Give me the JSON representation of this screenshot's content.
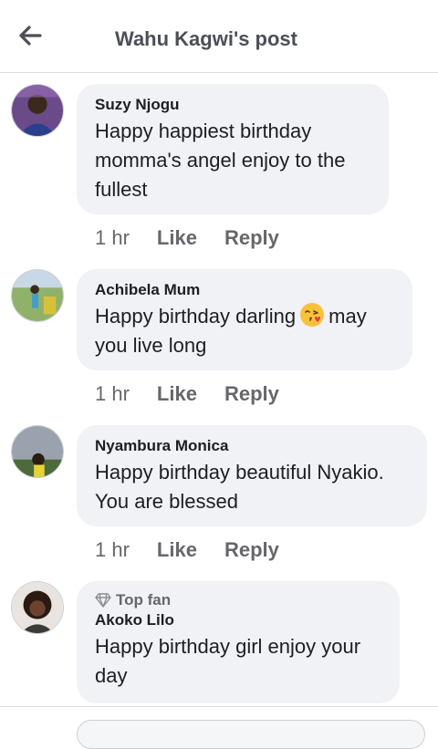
{
  "header": {
    "title": "Wahu Kagwi's post",
    "back_icon": "arrow-left-icon"
  },
  "comments": [
    {
      "author": "Suzy Njogu",
      "text": "Happy happiest birthday momma's angel enjoy to the fullest",
      "time": "1 hr",
      "like": "Like",
      "reply": "Reply"
    },
    {
      "author": "Achibela Mum",
      "text_before": "Happy birthday darling",
      "emoji": "face-blowing-kiss",
      "text_after": "may you live long",
      "time": "1 hr",
      "like": "Like",
      "reply": "Reply"
    },
    {
      "author": "Nyambura Monica",
      "text": "Happy birthday beautiful Nyakio. You are blessed",
      "time": "1 hr",
      "like": "Like",
      "reply": "Reply"
    },
    {
      "badge": "Top fan",
      "badge_icon": "diamond-icon",
      "author": "Akoko Lilo",
      "text": "Happy birthday girl enjoy your day"
    }
  ],
  "colors": {
    "bubble": "#f0f2f5",
    "muted": "#65676b",
    "title": "#4b4f56"
  }
}
